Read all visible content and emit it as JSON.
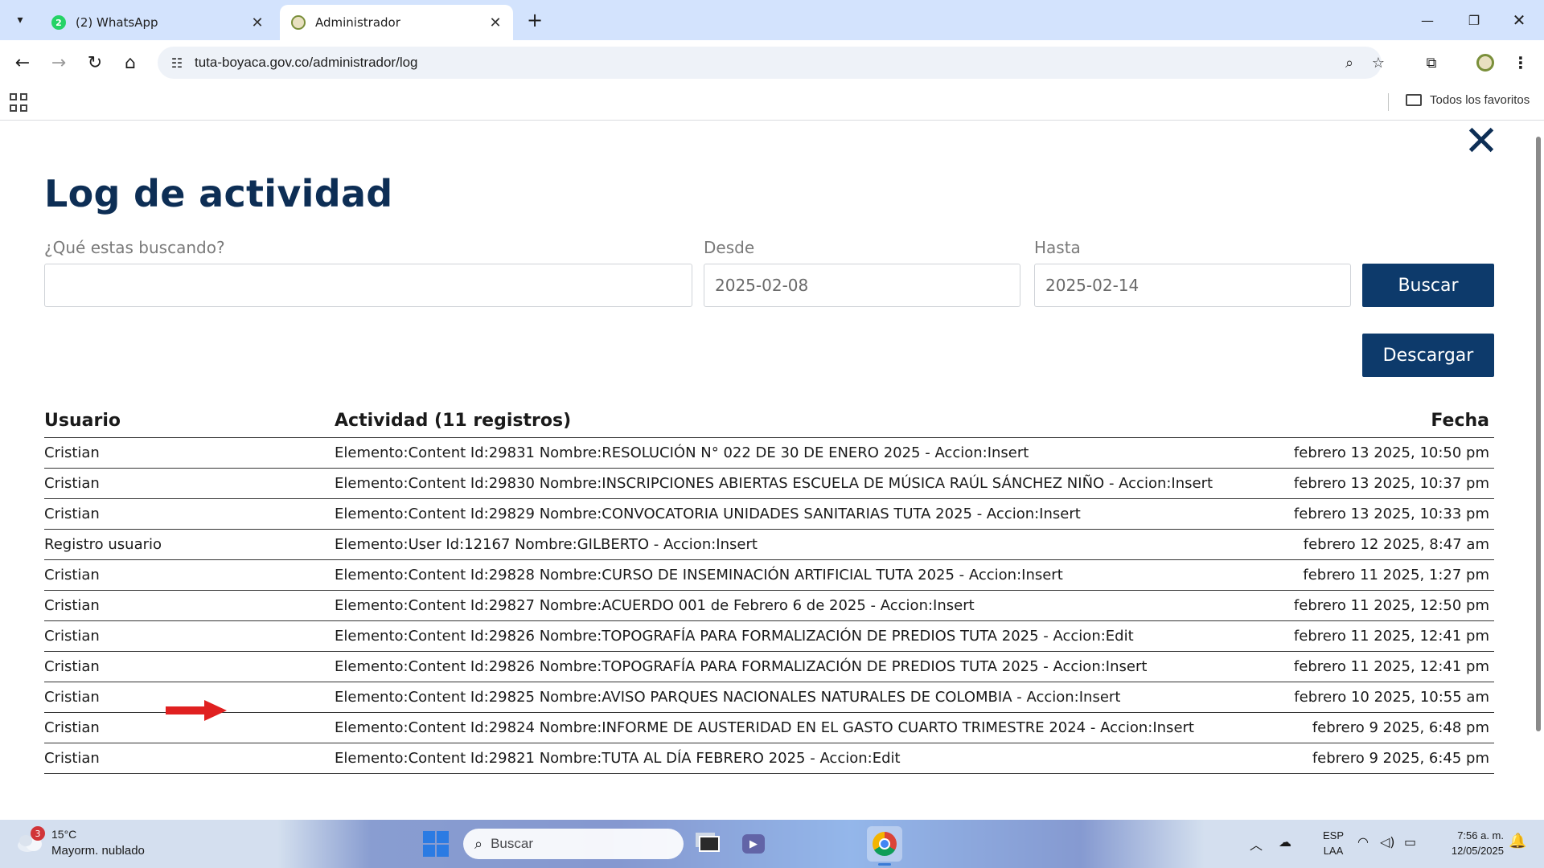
{
  "browser": {
    "tabs": [
      {
        "title": "(2) WhatsApp",
        "badge": "2",
        "active": false
      },
      {
        "title": "Administrador",
        "active": true
      }
    ],
    "url": "tuta-boyaca.gov.co/administrador/log",
    "bookmarks_all_label": "Todos los favoritos"
  },
  "page": {
    "title": "Log de actividad",
    "search": {
      "label": "¿Qué estas buscando?",
      "value": ""
    },
    "desde": {
      "label": "Desde",
      "value": "2025-02-08"
    },
    "hasta": {
      "label": "Hasta",
      "value": "2025-02-14"
    },
    "buscar_label": "Buscar",
    "descargar_label": "Descargar",
    "table": {
      "headers": {
        "usuario": "Usuario",
        "actividad": "Actividad (11 registros)",
        "fecha": "Fecha"
      },
      "rows": [
        {
          "usuario": "Cristian",
          "actividad": "Elemento:Content Id:29831 Nombre:RESOLUCIÓN N° 022 DE 30 DE ENERO 2025 - Accion:Insert",
          "fecha": "febrero 13 2025, 10:50 pm"
        },
        {
          "usuario": "Cristian",
          "actividad": "Elemento:Content Id:29830 Nombre:INSCRIPCIONES ABIERTAS ESCUELA DE MÚSICA RAÚL SÁNCHEZ NIÑO - Accion:Insert",
          "fecha": "febrero 13 2025, 10:37 pm"
        },
        {
          "usuario": "Cristian",
          "actividad": "Elemento:Content Id:29829 Nombre:CONVOCATORIA UNIDADES SANITARIAS TUTA 2025 - Accion:Insert",
          "fecha": "febrero 13 2025, 10:33 pm"
        },
        {
          "usuario": "Registro usuario",
          "actividad": "Elemento:User Id:12167 Nombre:GILBERTO - Accion:Insert",
          "fecha": "febrero 12 2025, 8:47 am"
        },
        {
          "usuario": "Cristian",
          "actividad": "Elemento:Content Id:29828 Nombre:CURSO DE INSEMINACIÓN ARTIFICIAL TUTA 2025 - Accion:Insert",
          "fecha": "febrero 11 2025, 1:27 pm"
        },
        {
          "usuario": "Cristian",
          "actividad": "Elemento:Content Id:29827 Nombre:ACUERDO 001 de Febrero 6 de 2025 - Accion:Insert",
          "fecha": "febrero 11 2025, 12:50 pm"
        },
        {
          "usuario": "Cristian",
          "actividad": "Elemento:Content Id:29826 Nombre:TOPOGRAFÍA PARA FORMALIZACIÓN DE PREDIOS TUTA 2025 - Accion:Edit",
          "fecha": "febrero 11 2025, 12:41 pm"
        },
        {
          "usuario": "Cristian",
          "actividad": "Elemento:Content Id:29826 Nombre:TOPOGRAFÍA PARA FORMALIZACIÓN DE PREDIOS TUTA 2025 - Accion:Insert",
          "fecha": "febrero 11 2025, 12:41 pm"
        },
        {
          "usuario": "Cristian",
          "actividad": "Elemento:Content Id:29825 Nombre:AVISO PARQUES NACIONALES NATURALES DE COLOMBIA - Accion:Insert",
          "fecha": "febrero 10 2025, 10:55 am"
        },
        {
          "usuario": "Cristian",
          "actividad": "Elemento:Content Id:29824 Nombre:INFORME DE AUSTERIDAD EN EL GASTO CUARTO TRIMESTRE 2024 - Accion:Insert",
          "fecha": "febrero 9 2025, 6:48 pm"
        },
        {
          "usuario": "Cristian",
          "actividad": "Elemento:Content Id:29821 Nombre:TUTA AL DÍA FEBRERO 2025 - Accion:Edit",
          "fecha": "febrero 9 2025, 6:45 pm"
        }
      ]
    }
  },
  "taskbar": {
    "weather_badge": "3",
    "weather_temp": "15°C",
    "weather_desc": "Mayorm. nublado",
    "search_placeholder": "Buscar",
    "lang_line1": "ESP",
    "lang_line2": "LAA",
    "time": "7:56 a. m.",
    "date": "12/05/2025"
  },
  "colors": {
    "brand_navy": "#0d3a6b",
    "title_navy": "#0d2e55",
    "annotation_arrow": "#e02020",
    "tabbar_bg": "#d3e3fd"
  },
  "icons": [
    "tab-search-icon",
    "whatsapp-icon",
    "site-crest-icon",
    "close-icon",
    "plus-icon",
    "back-icon",
    "forward-icon",
    "reload-icon",
    "home-icon",
    "site-info-icon",
    "zoom-icon",
    "star-icon",
    "extensions-icon",
    "menu-icon",
    "apps-icon",
    "folder-icon",
    "weather-icon",
    "windows-start-icon",
    "search-icon",
    "task-view-icon",
    "chrome-icon",
    "wifi-icon",
    "volume-icon",
    "battery-icon",
    "bell-icon"
  ]
}
